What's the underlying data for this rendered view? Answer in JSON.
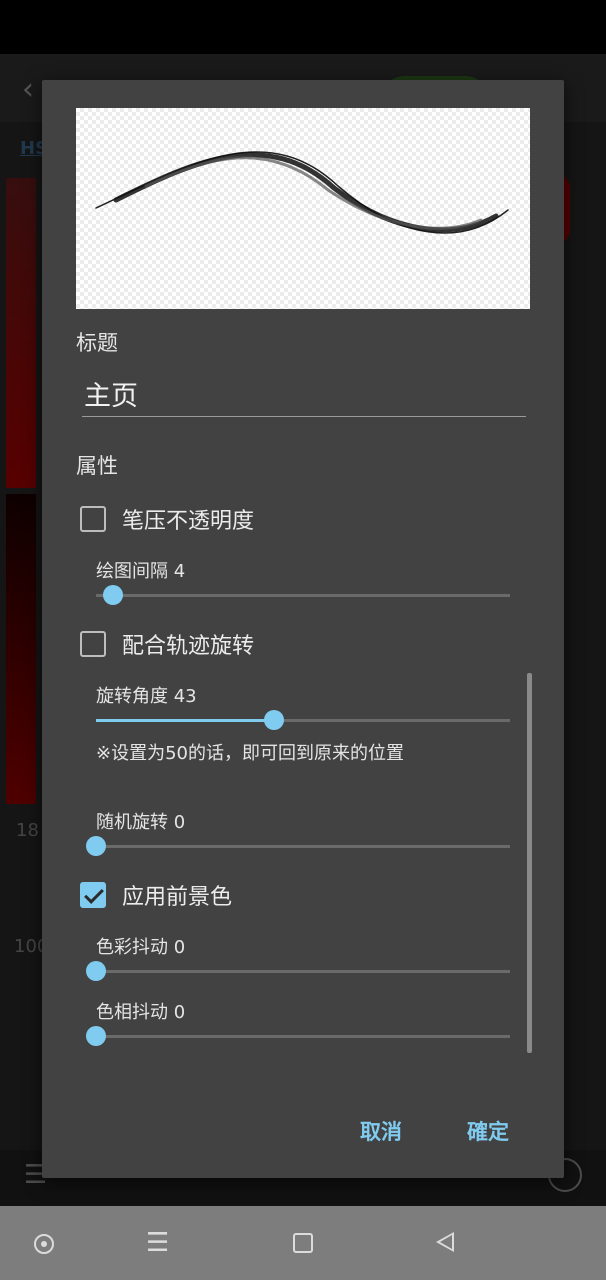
{
  "background": {
    "hs_tab": "HS",
    "value_18": "18",
    "value_100": "100"
  },
  "dialog": {
    "title_label": "标题",
    "title_value": "主页",
    "properties_label": "属性",
    "pen_pressure_opacity": {
      "label": "笔压不透明度",
      "checked": false
    },
    "draw_interval": {
      "label": "绘图间隔 4",
      "value": 4
    },
    "follow_path_rotation": {
      "label": "配合轨迹旋转",
      "checked": false
    },
    "rotation_angle": {
      "label": "旋转角度 43",
      "value": 43,
      "max": 100,
      "fill_percent": 43
    },
    "rotation_note": "※设置为50的话，即可回到原来的位置",
    "random_rotation": {
      "label": "随机旋转  0",
      "value": 0
    },
    "apply_foreground_color": {
      "label": "应用前景色",
      "checked": true
    },
    "color_jitter": {
      "label": "色彩抖动  0",
      "value": 0
    },
    "hue_jitter": {
      "label": "色相抖动  0",
      "value": 0
    },
    "cancel_label": "取消",
    "ok_label": "確定"
  },
  "colors": {
    "accent": "#80cbf0",
    "dialog_bg": "#424242"
  },
  "icons": [
    "checkbox-icon",
    "recent-apps-icon",
    "menu-icon",
    "home-icon",
    "back-icon"
  ]
}
